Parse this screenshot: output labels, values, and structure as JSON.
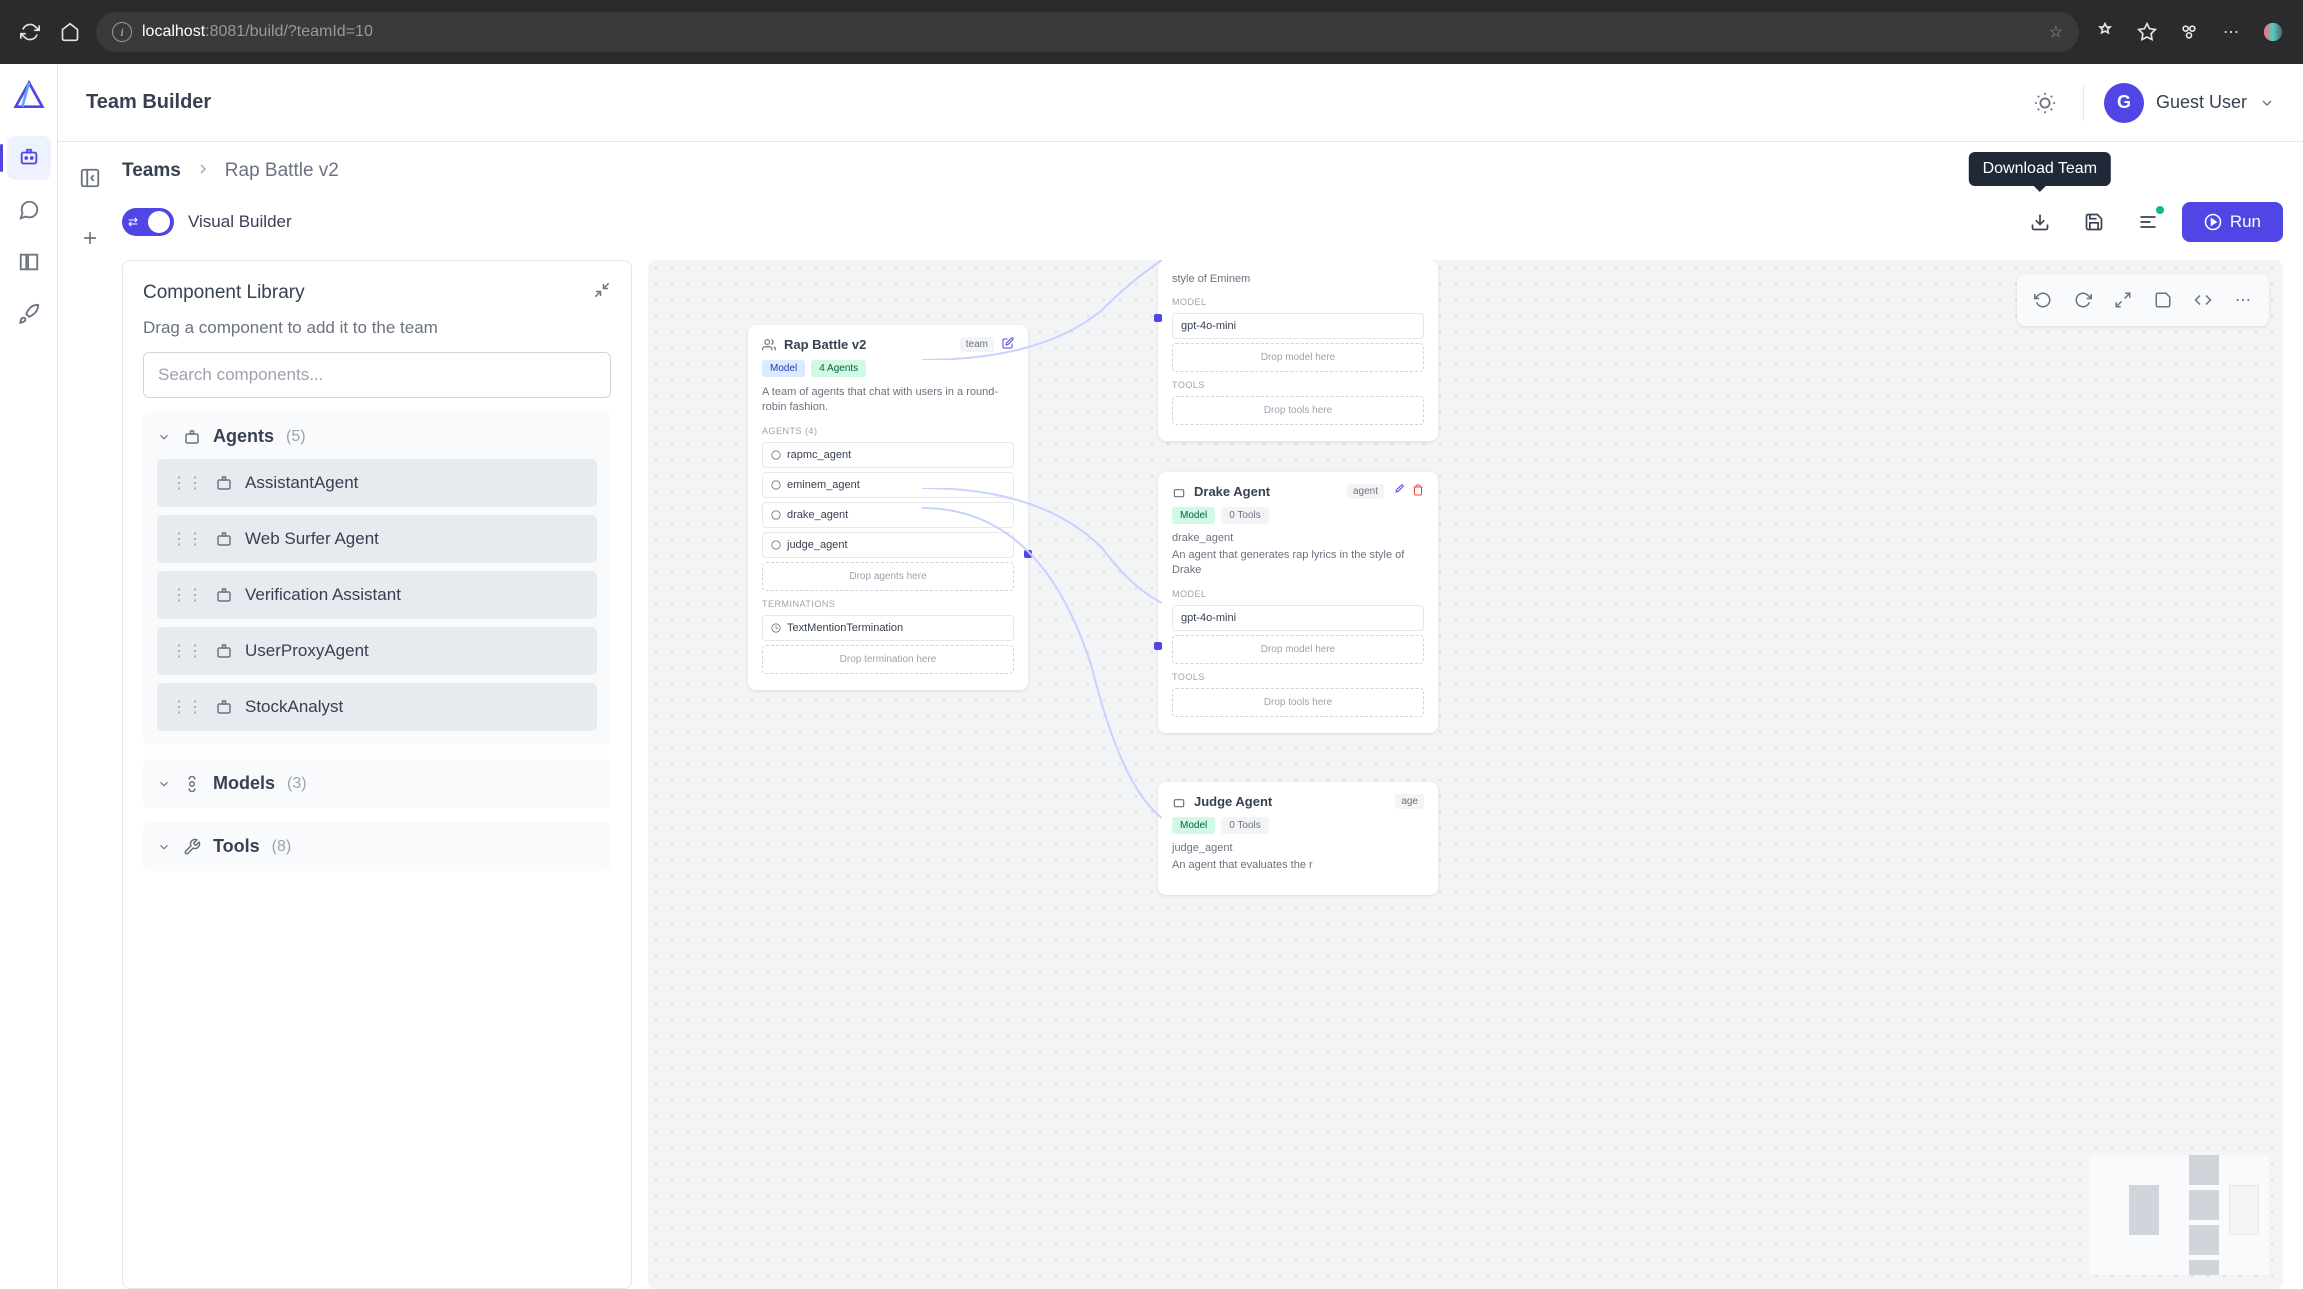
{
  "browser": {
    "url_host": "localhost",
    "url_rest": ":8081/build/?teamId=10"
  },
  "app": {
    "title": "Team Builder",
    "user": {
      "initial": "G",
      "name": "Guest User"
    }
  },
  "breadcrumb": {
    "root": "Teams",
    "current": "Rap Battle v2"
  },
  "toolbar": {
    "toggle_label": "Visual Builder",
    "tooltip": "Download Team",
    "run_label": "Run"
  },
  "library": {
    "title": "Component Library",
    "hint": "Drag a component to add it to the team",
    "search_placeholder": "Search components...",
    "sections": [
      {
        "name": "Agents",
        "count": "(5)",
        "expanded": true,
        "items": [
          "AssistantAgent",
          "Web Surfer Agent",
          "Verification Assistant",
          "UserProxyAgent",
          "StockAnalyst"
        ]
      },
      {
        "name": "Models",
        "count": "(3)",
        "expanded": false,
        "items": []
      },
      {
        "name": "Tools",
        "count": "(8)",
        "expanded": false,
        "items": []
      }
    ]
  },
  "canvas": {
    "team_node": {
      "title": "Rap Battle v2",
      "badge": "team",
      "pill_model": "Model",
      "pill_agents": "4 Agents",
      "description": "A team of agents that chat with users in a round-robin fashion.",
      "agents_label": "AGENTS (4)",
      "agents": [
        "rapmc_agent",
        "eminem_agent",
        "drake_agent",
        "judge_agent"
      ],
      "drop_agents": "Drop agents here",
      "term_label": "TERMINATIONS",
      "terminations": [
        "TextMentionTermination"
      ],
      "drop_term": "Drop termination here"
    },
    "eminem_node": {
      "desc_partial": "style of Eminem",
      "model_label": "MODEL",
      "model": "gpt-4o-mini",
      "drop_model": "Drop model here",
      "tools_label": "TOOLS",
      "drop_tools": "Drop tools here"
    },
    "drake_node": {
      "title": "Drake Agent",
      "badge": "agent",
      "pill_model": "Model",
      "pill_tools": "0 Tools",
      "name": "drake_agent",
      "desc": "An agent that generates rap lyrics in the style of Drake",
      "model_label": "MODEL",
      "model": "gpt-4o-mini",
      "drop_model": "Drop model here",
      "tools_label": "TOOLS",
      "drop_tools": "Drop tools here"
    },
    "judge_node": {
      "title": "Judge Agent",
      "badge": "age",
      "pill_model": "Model",
      "pill_tools": "0 Tools",
      "name": "judge_agent",
      "desc_partial": "An agent that evaluates the r"
    }
  }
}
